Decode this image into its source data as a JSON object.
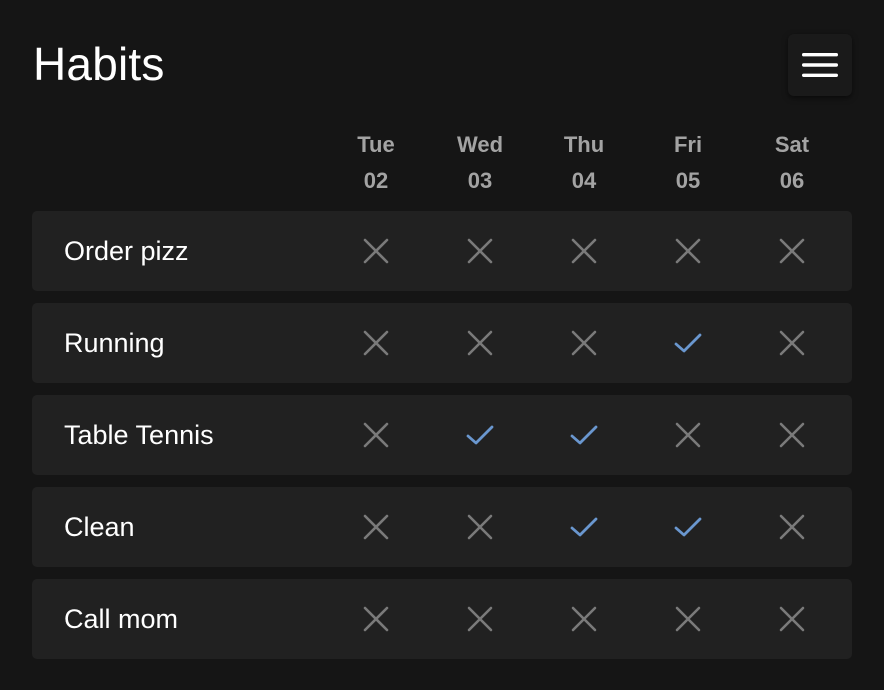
{
  "header": {
    "title": "Habits",
    "menu_icon": "hamburger-menu-icon"
  },
  "days": [
    {
      "dow": "Tue",
      "dom": "02"
    },
    {
      "dow": "Wed",
      "dom": "03"
    },
    {
      "dow": "Thu",
      "dom": "04"
    },
    {
      "dow": "Fri",
      "dom": "05"
    },
    {
      "dow": "Sat",
      "dom": "06"
    }
  ],
  "habits": [
    {
      "name": "Order pizz",
      "checks": [
        false,
        false,
        false,
        false,
        false
      ]
    },
    {
      "name": "Running",
      "checks": [
        false,
        false,
        false,
        true,
        false
      ]
    },
    {
      "name": "Table Tennis",
      "checks": [
        false,
        true,
        true,
        false,
        false
      ]
    },
    {
      "name": "Clean",
      "checks": [
        false,
        false,
        true,
        true,
        false
      ]
    },
    {
      "name": "Call mom",
      "checks": [
        false,
        false,
        false,
        false,
        false
      ]
    }
  ],
  "icons": {
    "done": "check-icon",
    "not_done": "cross-icon"
  },
  "colors": {
    "background": "#151515",
    "row_background": "#212121",
    "check": "#6a97cf",
    "cross": "#7a7a7a",
    "day_label": "#a3a3a3",
    "text": "#ffffff"
  }
}
